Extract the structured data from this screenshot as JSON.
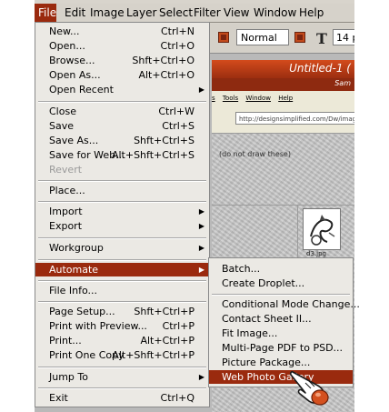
{
  "menubar": {
    "items": [
      "File",
      "Edit",
      "Image",
      "Layer",
      "Select",
      "Filter",
      "View",
      "Window",
      "Help"
    ]
  },
  "options_bar": {
    "blend_mode": "Normal",
    "font_size": "14 p"
  },
  "document": {
    "title": "Untitled-1 (",
    "subtitle": "Sam"
  },
  "browser": {
    "menu_items": [
      "s",
      "Tools",
      "Window",
      "Help"
    ],
    "address": "http://designsimplified.com/Dw/imagesfiles/",
    "page_note": "(do not draw these)",
    "thumb_caption": "d3.jpg"
  },
  "file_menu": {
    "items": [
      {
        "label": "New...",
        "shortcut": "Ctrl+N"
      },
      {
        "label": "Open...",
        "shortcut": "Ctrl+O"
      },
      {
        "label": "Browse...",
        "shortcut": "Shft+Ctrl+O"
      },
      {
        "label": "Open As...",
        "shortcut": "Alt+Ctrl+O"
      },
      {
        "label": "Open Recent",
        "shortcut": ""
      },
      {
        "label": "Close",
        "shortcut": "Ctrl+W"
      },
      {
        "label": "Save",
        "shortcut": "Ctrl+S"
      },
      {
        "label": "Save As...",
        "shortcut": "Shft+Ctrl+S"
      },
      {
        "label": "Save for Web...",
        "shortcut": "Alt+Shft+Ctrl+S"
      },
      {
        "label": "Revert",
        "shortcut": ""
      },
      {
        "label": "Place...",
        "shortcut": ""
      },
      {
        "label": "Import",
        "shortcut": ""
      },
      {
        "label": "Export",
        "shortcut": ""
      },
      {
        "label": "Workgroup",
        "shortcut": ""
      },
      {
        "label": "Automate",
        "shortcut": ""
      },
      {
        "label": "File Info...",
        "shortcut": ""
      },
      {
        "label": "Page Setup...",
        "shortcut": "Shft+Ctrl+P"
      },
      {
        "label": "Print with Preview...",
        "shortcut": "Ctrl+P"
      },
      {
        "label": "Print...",
        "shortcut": "Alt+Ctrl+P"
      },
      {
        "label": "Print One Copy",
        "shortcut": "Alt+Shft+Ctrl+P"
      },
      {
        "label": "Jump To",
        "shortcut": ""
      },
      {
        "label": "Exit",
        "shortcut": "Ctrl+Q"
      }
    ]
  },
  "automate_menu": {
    "items": [
      {
        "label": "Batch..."
      },
      {
        "label": "Create Droplet..."
      },
      {
        "label": "Conditional Mode Change..."
      },
      {
        "label": "Contact Sheet II..."
      },
      {
        "label": "Fit Image..."
      },
      {
        "label": "Multi-Page PDF to PSD..."
      },
      {
        "label": "Picture Package..."
      },
      {
        "label": "Web Photo Gallery"
      }
    ]
  },
  "colors": {
    "accent": "#9a2a0e",
    "menu_bg": "#ebe9e4",
    "doc_titlebar": "#c5421a"
  },
  "icons": {
    "submenu_arrow": "triangle-right",
    "pointer": "hand-pointer"
  }
}
